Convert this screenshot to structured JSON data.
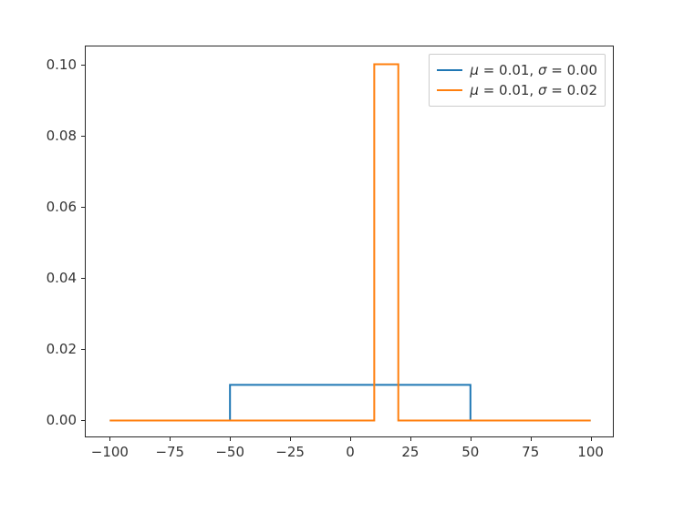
{
  "chart_data": {
    "type": "line",
    "x": [
      -100,
      -75,
      -50,
      -25,
      0,
      25,
      50,
      75,
      100
    ],
    "series": [
      {
        "name": "μ = 0.01, σ = 0.00",
        "color": "#1f77b4",
        "points": [
          {
            "x": -100,
            "y": 0.0
          },
          {
            "x": -50,
            "y": 0.0
          },
          {
            "x": -50,
            "y": 0.01
          },
          {
            "x": 50,
            "y": 0.01
          },
          {
            "x": 50,
            "y": 0.0
          },
          {
            "x": 100,
            "y": 0.0
          }
        ]
      },
      {
        "name": "μ = 0.01, σ = 0.02",
        "color": "#ff7f0e",
        "points": [
          {
            "x": -100,
            "y": 0.0
          },
          {
            "x": 10,
            "y": 0.0
          },
          {
            "x": 10,
            "y": 0.1
          },
          {
            "x": 20,
            "y": 0.1
          },
          {
            "x": 20,
            "y": 0.0
          },
          {
            "x": 100,
            "y": 0.0
          }
        ]
      }
    ],
    "xlabel": "",
    "ylabel": "",
    "title": "",
    "xlim": [
      -110,
      110
    ],
    "ylim": [
      -0.005,
      0.105
    ],
    "xticks": [
      -100,
      -75,
      -50,
      -25,
      0,
      25,
      50,
      75,
      100
    ],
    "yticks": [
      0.0,
      0.02,
      0.04,
      0.06,
      0.08,
      0.1
    ]
  },
  "xtick_labels": {
    "m100": "−100",
    "m75": "−75",
    "m50": "−50",
    "m25": "−25",
    "z0": "0",
    "p25": "25",
    "p50": "50",
    "p75": "75",
    "p100": "100"
  },
  "ytick_labels": {
    "y0": "0.00",
    "y02": "0.02",
    "y04": "0.04",
    "y06": "0.06",
    "y08": "0.08",
    "y10": "0.10"
  },
  "legend": {
    "entry0_mu": "μ",
    "entry0_eq1": " = 0.01, ",
    "entry0_sig": "σ",
    "entry0_eq2": " = 0.00",
    "entry1_mu": "μ",
    "entry1_eq1": " = 0.01, ",
    "entry1_sig": "σ",
    "entry1_eq2": " = 0.02"
  },
  "colors": {
    "series0": "#1f77b4",
    "series1": "#ff7f0e"
  },
  "layout": {
    "axes_left": 93,
    "axes_top": 50,
    "axes_width": 580,
    "axes_height": 430
  }
}
